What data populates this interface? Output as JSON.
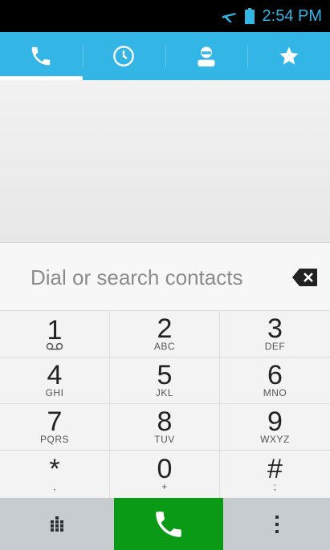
{
  "status_bar": {
    "time": "2:54 PM"
  },
  "tabs": [
    {
      "icon": "phone-icon",
      "active": true
    },
    {
      "icon": "clock-icon",
      "active": false
    },
    {
      "icon": "contact-icon",
      "active": false
    },
    {
      "icon": "star-icon",
      "active": false
    }
  ],
  "dial_field": {
    "placeholder": "Dial or search contacts"
  },
  "keypad": {
    "keys": [
      {
        "digit": "1",
        "letters": ""
      },
      {
        "digit": "2",
        "letters": "ABC"
      },
      {
        "digit": "3",
        "letters": "DEF"
      },
      {
        "digit": "4",
        "letters": "GHI"
      },
      {
        "digit": "5",
        "letters": "JKL"
      },
      {
        "digit": "6",
        "letters": "MNO"
      },
      {
        "digit": "7",
        "letters": "PQRS"
      },
      {
        "digit": "8",
        "letters": "TUV"
      },
      {
        "digit": "9",
        "letters": "WXYZ"
      },
      {
        "digit": "*",
        "letters": ","
      },
      {
        "digit": "0",
        "letters": "+"
      },
      {
        "digit": "#",
        "letters": ";"
      }
    ]
  },
  "colors": {
    "accent": "#33b5e5",
    "call_button": "#0b9a15"
  }
}
